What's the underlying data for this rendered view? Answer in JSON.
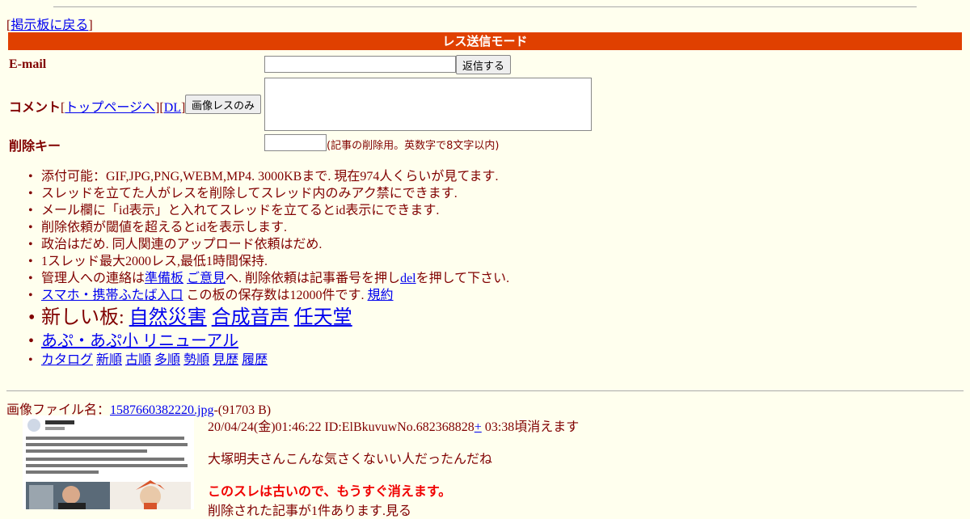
{
  "nav": {
    "back_open": "[",
    "back_label": "掲示板に戻る",
    "back_close": "]"
  },
  "form": {
    "mode_title": "レス送信モード",
    "email_label": "E-mail",
    "submit_label": "返信する",
    "comment_label": "コメント",
    "comment_links": {
      "open1": "[",
      "top_page": "トップページへ",
      "mid": "][",
      "dl": "DL",
      "close": "]"
    },
    "image_only_label": "画像レスのみ",
    "delete_key_label": "削除キー",
    "delete_key_hint": "(記事の削除用。英数字で8文字以内)"
  },
  "rules": {
    "r1": "添付可能：GIF,JPG,PNG,WEBM,MP4. 3000KBまで. 現在974人くらいが見てます.",
    "r2": "スレッドを立てた人がレスを削除してスレッド内のみアク禁にできます.",
    "r3": "メール欄に「id表示」と入れてスレッドを立てるとid表示にできます.",
    "r4": "削除依頼が閾値を超えるとidを表示します.",
    "r5": "政治はだめ. 同人関連のアップロード依頼はだめ.",
    "r6": "1スレッド最大2000レス,最低1時間保持.",
    "r7_a": "管理人への連絡は",
    "r7_link1": "準備板",
    "r7_link2": "ご意見",
    "r7_b": "へ. 削除依頼は記事番号を押し",
    "r7_del": "del",
    "r7_c": "を押して下さい.",
    "r8_link": "スマホ・携帯ふたば入口",
    "r8_text": " この板の保存数は12000件です. ",
    "r8_rules": "規約",
    "new_boards_label": "新しい板: ",
    "new_boards": [
      "自然災害",
      "合成音声",
      "任天堂"
    ],
    "apu_link": "あぷ・あぷ小 リニューアル",
    "catalog_links": [
      "カタログ",
      "新順",
      "古順",
      "多順",
      "勢順",
      "見歴",
      "履歴"
    ]
  },
  "thread": {
    "file_label": "画像ファイル名：",
    "file_name": "1587660382220.jpg",
    "file_size": "-(91703 B)",
    "date": "20/04/24(金)01:46:22 ID:ElBkuvuwNo.682368828",
    "plus": "+",
    "expire": " 03:38頃消えます",
    "body": "大塚明夫さんこんな気さくないい人だったんだね",
    "warning": "このスレは古いので、もうすぐ消えます。",
    "deleted_note": "削除された記事が1件あります.見る"
  },
  "colors": {
    "accent": "#e04000",
    "text": "#800000",
    "background": "#ffffee",
    "link": "#0000ee",
    "warning": "#f00000"
  }
}
